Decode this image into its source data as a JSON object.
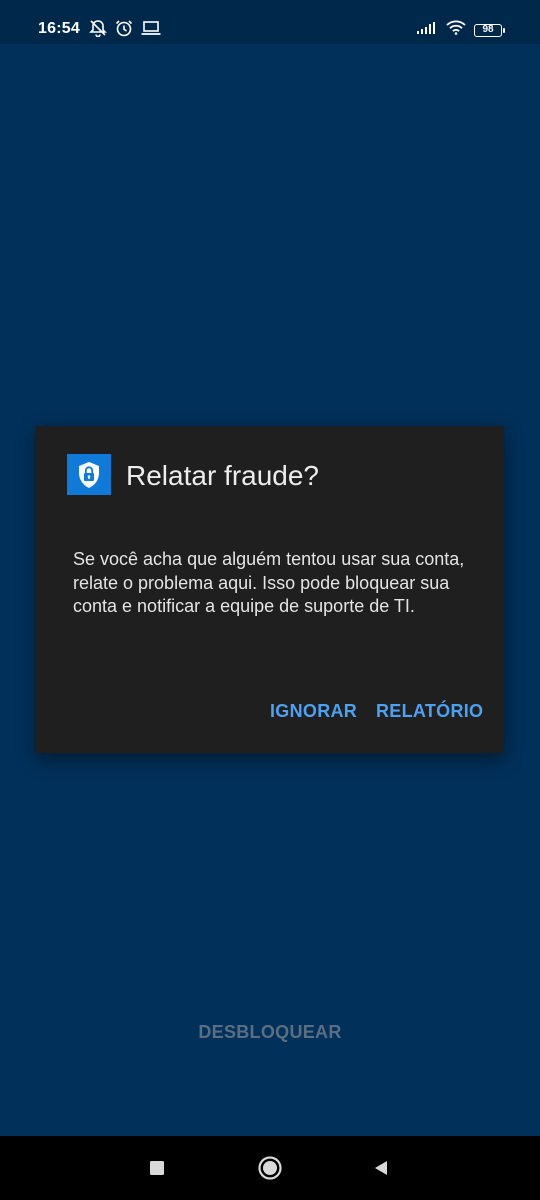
{
  "status_bar": {
    "time": "16:54",
    "battery_level": "98",
    "left_icons": [
      "notifications-off-icon",
      "alarm-icon",
      "laptop-icon"
    ],
    "right_icons": [
      "signal-icon",
      "wifi-icon",
      "battery-icon"
    ]
  },
  "dialog": {
    "icon": "shield-lock-icon",
    "title": "Relatar fraude?",
    "body": "Se você acha que alguém tentou usar sua conta, relate o problema aqui. Isso pode bloquear sua conta e notificar a equipe de suporte de TI.",
    "ignore_label": "IGNORAR",
    "report_label": "RELATÓRIO"
  },
  "unlock_label": "DESBLOQUEAR",
  "nav_bar": {
    "icons": [
      "recents-icon",
      "home-icon",
      "back-icon"
    ]
  },
  "colors": {
    "background": "#01305a",
    "status_bar": "#00284b",
    "dialog_bg": "#1f1f1f",
    "accent": "#4da1f2",
    "icon_bg": "#0f7ad8",
    "muted_button": "#5a6e82"
  }
}
